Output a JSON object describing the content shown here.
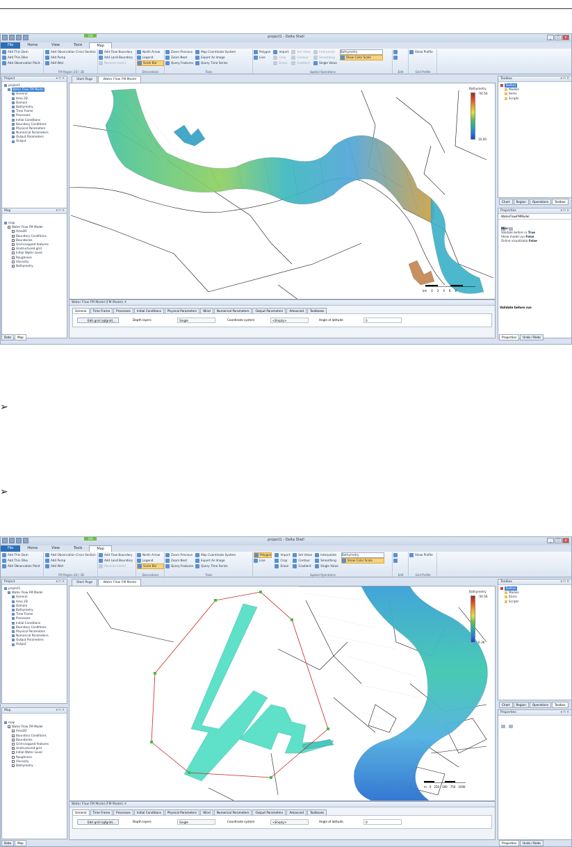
{
  "window": {
    "title": "project1 - Delta Shell",
    "gis_tab": "GIS",
    "menu_tabs": [
      "File",
      "Home",
      "View",
      "Tools",
      "Map"
    ]
  },
  "ribbon": {
    "group1": {
      "items": [
        "Add Thin Dam",
        "Add Thin Dike",
        "Add Observation Point",
        "Add Observation Cross Section",
        "Add Pump",
        "Add Weir",
        "Add Flow Boundary",
        "Add Land Boundary",
        "Reverse line(s)"
      ],
      "label": "FM Region 2D / 3D"
    },
    "group2": {
      "items": [
        "North Arrow",
        "Legend",
        "Scale Bar"
      ],
      "label": "Decorations"
    },
    "group3": {
      "items": [
        "Zoom Previous",
        "Zoom Next",
        "Query Features",
        "Map Coordinate System",
        "Export As Image",
        "Query Time Series"
      ],
      "label": "Tools"
    },
    "group4": {
      "items": [
        "Polygon",
        "Line",
        "Import",
        "Crop",
        "Erase",
        "Set Value",
        "Contour",
        "Gradient",
        "Interpolate",
        "Smoothing",
        "Single Value"
      ],
      "coverage": "Bathymetry",
      "color_scale": "Show Color Scale",
      "label": "Spatial Operations"
    },
    "group5": {
      "label": "Edit"
    },
    "group6": {
      "items": [
        "Show Profile"
      ],
      "label": "Grid Profile"
    }
  },
  "project_panel": {
    "title": "Project",
    "items": [
      "project1",
      "Water Flow FM Model",
      "General",
      "Area 2D",
      "Domain",
      "Bathymetry",
      "Time Frame",
      "Processes",
      "Initial Conditions",
      "Boundary Conditions",
      "Physical Parameters",
      "Numerical Parameters",
      "Output Parameters",
      "Output"
    ]
  },
  "map_panel": {
    "title": "Map",
    "items_top": [
      "map",
      "Water Flow FM Model",
      "Area2D",
      "Boundary Conditions",
      "Boundaries",
      "Grid-snapped features",
      "Unstructured grid",
      "Initial Water Level",
      "Roughness",
      "Viscosity",
      "Bathymetry"
    ],
    "items_bottom": [
      "map",
      "Water Flow FM Model",
      "Area2D",
      "Boundary Conditions",
      "Boundaries",
      "Grid-snapped features",
      "Unstructured grid",
      "Initial Water Level",
      "Roughness",
      "Viscosity",
      "Bathymetry"
    ],
    "tabs": [
      "Data",
      "Map"
    ]
  },
  "doc_tabs": [
    "Start Page",
    "Water Flow FM Model"
  ],
  "legend": {
    "title": "Bathymetry",
    "top_max": "-50.56",
    "top_min": "10.00",
    "bottom_max": "-50.56",
    "bottom_min": "6.36",
    "scale_top": [
      "km",
      "0",
      "2",
      "4",
      "6",
      "8"
    ],
    "scale_bottom": [
      "m",
      "0",
      "250",
      "500",
      "750",
      "1000"
    ]
  },
  "edit_pane": {
    "title": "Water Flow FM Model (FM Model)",
    "tabs": [
      "General",
      "Time Frame",
      "Processes",
      "Initial Conditions",
      "Physical Parameters",
      "Wind",
      "Numerical Parameters",
      "Output Parameters",
      "Advanced",
      "Toolboxes"
    ],
    "edit_grid": "Edit grid (rgfgrid)...",
    "depth_layers_label": "Depth layers",
    "depth_layers_value": "Single",
    "coord_label": "Coordinate system",
    "coord_value": "<Empty>",
    "lat_label": "Angle of latitude",
    "lat_value": "0"
  },
  "toolbox_panel": {
    "title": "Toolbox",
    "items": [
      "Toolbox",
      "Models",
      "Items",
      "Scripts"
    ],
    "tabs": [
      "Chart",
      "Region",
      "Operations",
      "Toolbox"
    ]
  },
  "properties_panel": {
    "title": "Properties",
    "object": "WaterFlowFMModel",
    "section": "Misc",
    "rows": [
      [
        "Validate before ru",
        "True"
      ],
      [
        "Show model run",
        "False"
      ],
      [
        "Online visualizatio",
        "False"
      ]
    ],
    "footer": "Validate before run",
    "tabs": [
      "Properties",
      "Undo / Redo"
    ]
  },
  "bullets": [
    "➢",
    "➢"
  ]
}
